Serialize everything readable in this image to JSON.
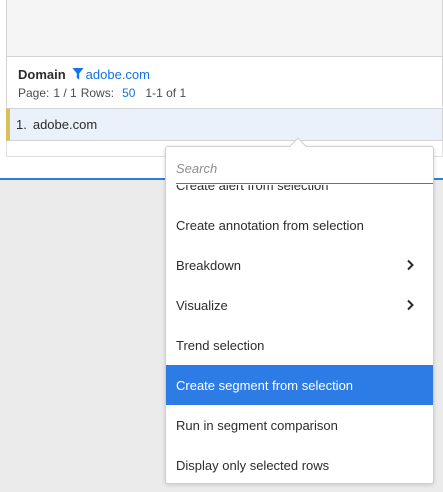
{
  "table": {
    "dimension_title": "Domain",
    "filter_value": "adobe.com",
    "page_label": "Page:",
    "page_value": "1 / 1",
    "rows_label": "Rows:",
    "rows_value": "50",
    "range_text": "1-1 of 1",
    "rows": [
      {
        "index": "1.",
        "value": "adobe.com"
      }
    ]
  },
  "context_menu": {
    "search_placeholder": "Search",
    "items": [
      {
        "label": "Create alert from selection",
        "has_submenu": false,
        "selected": false
      },
      {
        "label": "Create annotation from selection",
        "has_submenu": false,
        "selected": false
      },
      {
        "label": "Breakdown",
        "has_submenu": true,
        "selected": false
      },
      {
        "label": "Visualize",
        "has_submenu": true,
        "selected": false
      },
      {
        "label": "Trend selection",
        "has_submenu": false,
        "selected": false
      },
      {
        "label": "Create segment from selection",
        "has_submenu": false,
        "selected": true
      },
      {
        "label": "Run in segment comparison",
        "has_submenu": false,
        "selected": false
      },
      {
        "label": "Display only selected rows",
        "has_submenu": false,
        "selected": false
      }
    ]
  },
  "colors": {
    "accent": "#2d7be5",
    "link": "#1473e6",
    "row_highlight": "#eaf1fb",
    "row_marker": "#d6c15a"
  },
  "icons": {
    "filter": "filter-icon",
    "submenu": "chevron-right-icon"
  }
}
